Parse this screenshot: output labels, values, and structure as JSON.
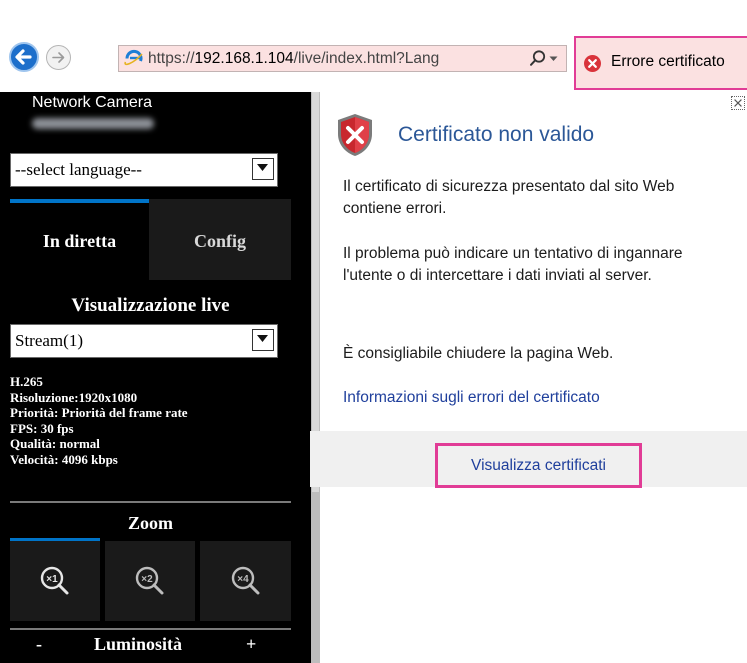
{
  "browser": {
    "url_prefix": "https://",
    "url_host": "192.168.1.104",
    "url_rest": "/live/index.html?Lang",
    "cert_error_label": "Errore certificato"
  },
  "camera": {
    "title": "Network Camera",
    "language_select": "--select language--",
    "tabs": {
      "live": "In diretta",
      "config": "Config"
    },
    "live_view_title": "Visualizzazione live",
    "stream_select": "Stream(1)",
    "stream_info": [
      "H.265",
      "Risoluzione:1920x1080",
      "Priorità: Priorità del frame rate",
      "FPS: 30 fps",
      "Qualità: normal",
      "Velocità:  4096 kbps"
    ],
    "zoom_title": "Zoom",
    "zoom_buttons": [
      "×1",
      "×2",
      "×4"
    ],
    "brightness": {
      "minus": "-",
      "label": "Luminosità",
      "plus": "+"
    }
  },
  "popup": {
    "title": "Certificato non valido",
    "paragraph1": "Il certificato di sicurezza presentato dal sito Web contiene errori.",
    "paragraph2": "Il problema può indicare un tentativo di ingannare l'utente o di intercettare i dati inviati al server.",
    "paragraph3": "È consigliabile chiudere la pagina Web.",
    "info_link": "Informazioni sugli errori del certificato",
    "view_certificates_button": "Visualizza certificati"
  },
  "colors": {
    "accent_pink": "#e13c96",
    "address_bar_error": "#fbe1e1",
    "link_blue": "#1f3f9c",
    "tab_blue": "#0074c8"
  }
}
